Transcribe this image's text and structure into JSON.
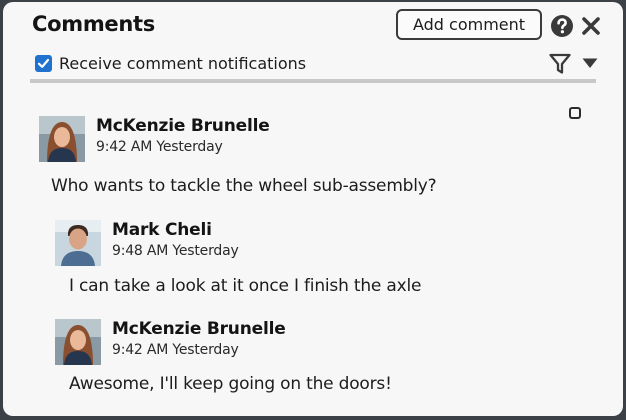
{
  "header": {
    "title": "Comments",
    "add_button_label": "Add comment",
    "help_icon": "help-circle-icon",
    "close_icon": "close-x-icon"
  },
  "notifications": {
    "label": "Receive comment notifications",
    "checked": true
  },
  "filter": {
    "icon": "filter-funnel-icon",
    "dropdown_icon": "caret-down-icon"
  },
  "colors": {
    "accent": "#1f73cf",
    "panel_bg": "#f7f7f7",
    "frame": "#3c4147",
    "divider": "#c8c8c8"
  },
  "comments": [
    {
      "author": "McKenzie Brunelle",
      "time": "9:42 AM Yesterday",
      "text": "Who wants to tackle the wheel sub-assembly?",
      "replies": [
        {
          "author": "Mark Cheli",
          "time": "9:48 AM Yesterday",
          "text": "I can take a look at it once I finish the axle"
        },
        {
          "author": "McKenzie Brunelle",
          "time": "9:42 AM Yesterday",
          "text": "Awesome, I'll keep going on the doors!"
        }
      ]
    }
  ]
}
